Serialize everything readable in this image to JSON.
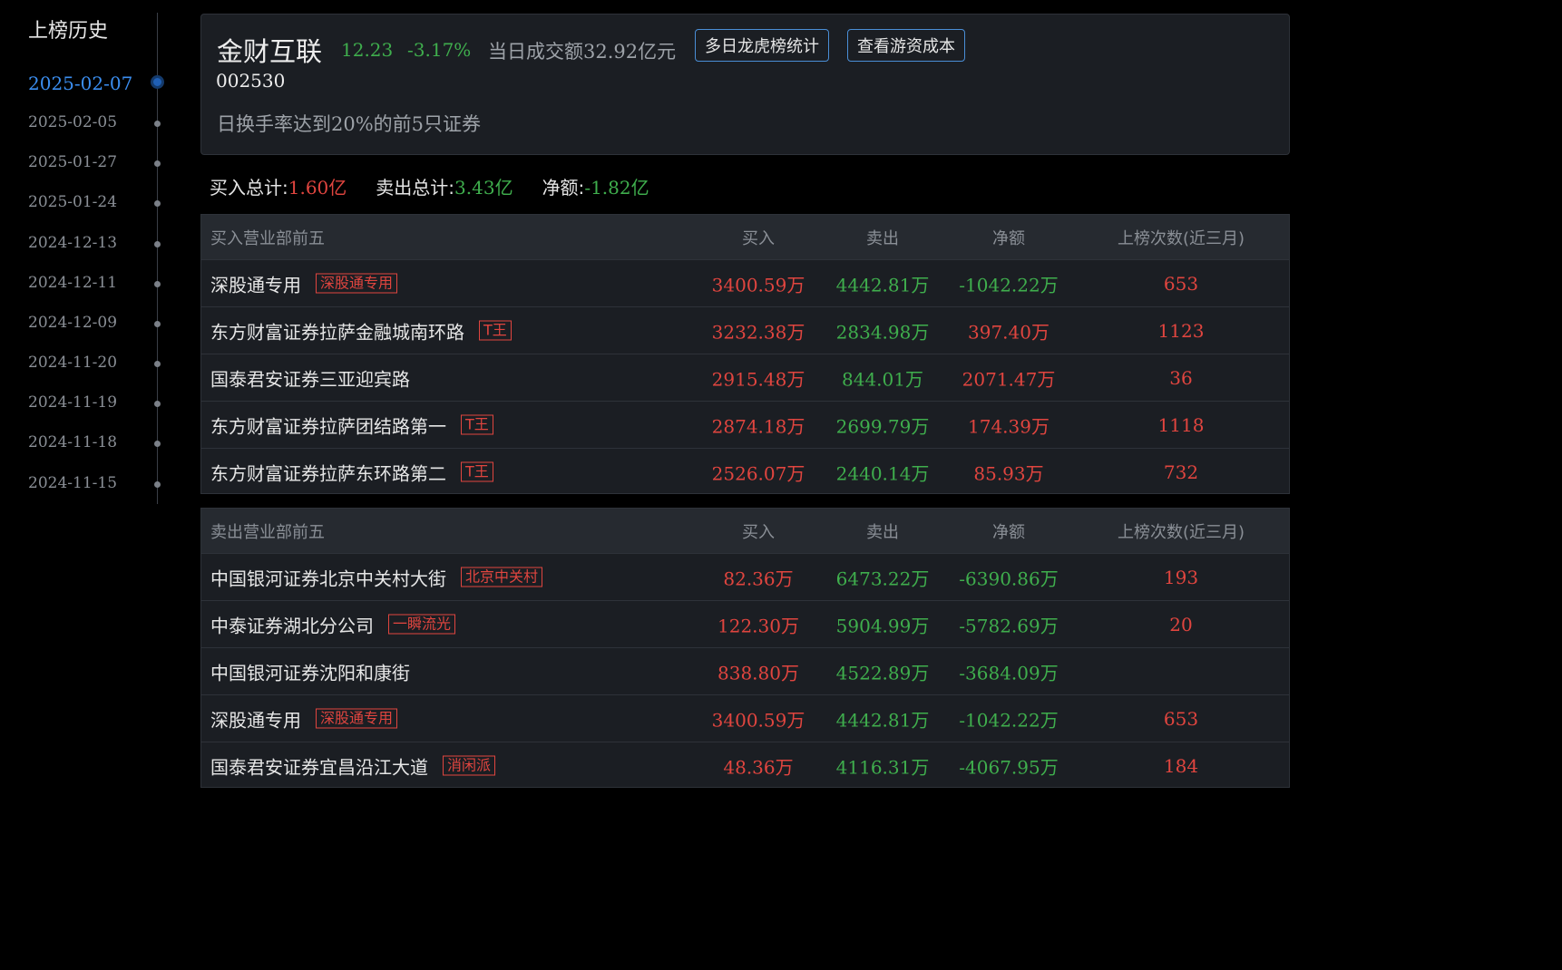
{
  "sidebar": {
    "title": "上榜历史",
    "dates": [
      "2025-02-07",
      "2025-02-05",
      "2025-01-27",
      "2025-01-24",
      "2024-12-13",
      "2024-12-11",
      "2024-12-09",
      "2024-11-20",
      "2024-11-19",
      "2024-11-18",
      "2024-11-15"
    ],
    "active_index": 0
  },
  "header": {
    "name": "金财互联",
    "price": "12.23",
    "change": "-3.17%",
    "turnover": "当日成交额32.92亿元",
    "code": "002530",
    "reason": "日换手率达到20%的前5只证券",
    "btn_multi_day": "多日龙虎榜统计",
    "btn_cost": "查看游资成本"
  },
  "totals": {
    "buy_label": "买入总计:",
    "buy_value": "1.60亿",
    "sell_label": "卖出总计:",
    "sell_value": "3.43亿",
    "net_label": "净额:",
    "net_value": "-1.82亿"
  },
  "buy_table": {
    "headers": [
      "买入营业部前五",
      "买入",
      "卖出",
      "净额",
      "上榜次数(近三月)"
    ],
    "rows": [
      {
        "name": "深股通专用",
        "tag": "深股通专用",
        "buy": "3400.59万",
        "sell": "4442.81万",
        "net": "-1042.22万",
        "count": "653"
      },
      {
        "name": "东方财富证券拉萨金融城南环路",
        "tag": "T王",
        "buy": "3232.38万",
        "sell": "2834.98万",
        "net": "397.40万",
        "count": "1123"
      },
      {
        "name": "国泰君安证券三亚迎宾路",
        "tag": "",
        "buy": "2915.48万",
        "sell": "844.01万",
        "net": "2071.47万",
        "count": "36"
      },
      {
        "name": "东方财富证券拉萨团结路第一",
        "tag": "T王",
        "buy": "2874.18万",
        "sell": "2699.79万",
        "net": "174.39万",
        "count": "1118"
      },
      {
        "name": "东方财富证券拉萨东环路第二",
        "tag": "T王",
        "buy": "2526.07万",
        "sell": "2440.14万",
        "net": "85.93万",
        "count": "732"
      }
    ]
  },
  "sell_table": {
    "headers": [
      "卖出营业部前五",
      "买入",
      "卖出",
      "净额",
      "上榜次数(近三月)"
    ],
    "rows": [
      {
        "name": "中国银河证券北京中关村大街",
        "tag": "北京中关村",
        "buy": "82.36万",
        "sell": "6473.22万",
        "net": "-6390.86万",
        "count": "193"
      },
      {
        "name": "中泰证券湖北分公司",
        "tag": "一瞬流光",
        "buy": "122.30万",
        "sell": "5904.99万",
        "net": "-5782.69万",
        "count": "20"
      },
      {
        "name": "中国银河证券沈阳和康街",
        "tag": "",
        "buy": "838.80万",
        "sell": "4522.89万",
        "net": "-3684.09万",
        "count": ""
      },
      {
        "name": "深股通专用",
        "tag": "深股通专用",
        "buy": "3400.59万",
        "sell": "4442.81万",
        "net": "-1042.22万",
        "count": "653"
      },
      {
        "name": "国泰君安证券宜昌沿江大道",
        "tag": "消闲派",
        "buy": "48.36万",
        "sell": "4116.31万",
        "net": "-4067.95万",
        "count": "184"
      }
    ]
  },
  "colors": {
    "up": "#e0453f",
    "down": "#3fae4d",
    "accent": "#3b8ef0"
  }
}
